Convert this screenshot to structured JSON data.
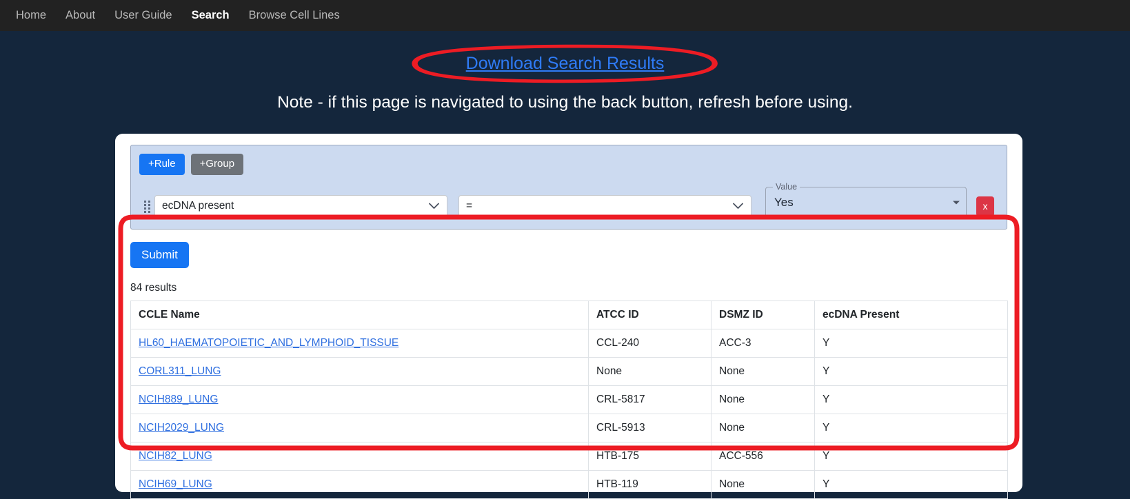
{
  "nav": {
    "items": [
      {
        "label": "Home",
        "active": false
      },
      {
        "label": "About",
        "active": false
      },
      {
        "label": "User Guide",
        "active": false
      },
      {
        "label": "Search",
        "active": true
      },
      {
        "label": "Browse Cell Lines",
        "active": false
      }
    ]
  },
  "hero": {
    "download_label": "Download Search Results",
    "note": "Note - if this page is navigated to using the back button, refresh before using."
  },
  "query_builder": {
    "add_rule_label": "+Rule",
    "add_group_label": "+Group",
    "rule": {
      "field": "ecDNA present",
      "operator": "=",
      "value_label": "Value",
      "value": "Yes",
      "delete_label": "x"
    }
  },
  "form": {
    "submit_label": "Submit"
  },
  "results": {
    "count_label": "84 results",
    "columns": [
      "CCLE Name",
      "ATCC ID",
      "DSMZ ID",
      "ecDNA Present"
    ],
    "rows": [
      {
        "name": "HL60_HAEMATOPOIETIC_AND_LYMPHOID_TISSUE",
        "atcc": "CCL-240",
        "dsmz": "ACC-3",
        "ecdna": "Y"
      },
      {
        "name": "CORL311_LUNG",
        "atcc": "None",
        "dsmz": "None",
        "ecdna": "Y"
      },
      {
        "name": "NCIH889_LUNG",
        "atcc": "CRL-5817",
        "dsmz": "None",
        "ecdna": "Y"
      },
      {
        "name": "NCIH2029_LUNG",
        "atcc": "CRL-5913",
        "dsmz": "None",
        "ecdna": "Y"
      },
      {
        "name": "NCIH82_LUNG",
        "atcc": "HTB-175",
        "dsmz": "ACC-556",
        "ecdna": "Y"
      },
      {
        "name": "NCIH69_LUNG",
        "atcc": "HTB-119",
        "dsmz": "None",
        "ecdna": "Y"
      }
    ]
  },
  "colors": {
    "page_background": "#14263c",
    "navbar_background": "#222222",
    "accent_blue": "#1675f3",
    "link_blue": "#2f7bf6",
    "annotation_red": "#ed1c24",
    "panel_blue": "#ccdaf0",
    "danger_red": "#dc3545"
  }
}
